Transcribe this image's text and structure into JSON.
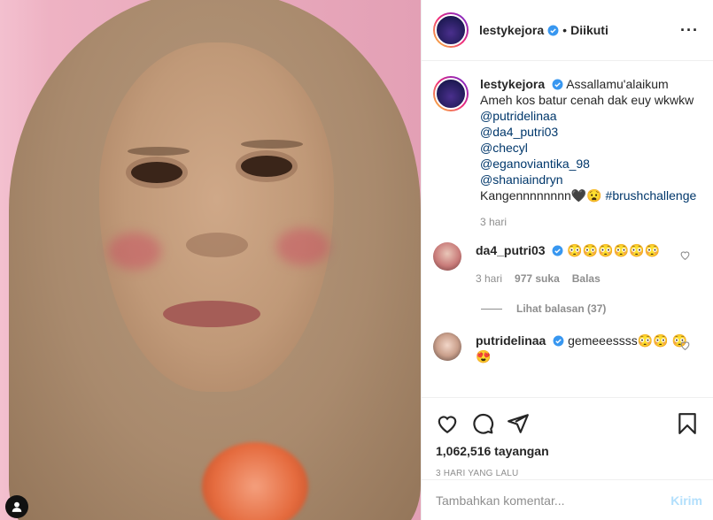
{
  "post": {
    "author": "lestykejora",
    "follow_status": "Diikuti",
    "separator": "•"
  },
  "caption": {
    "username": "lestykejora",
    "first_line": "Assallamu'alaikum",
    "line2": "Ameh kos batur cenah dak euy wkwkw",
    "mentions": [
      "@putridelinaa",
      "@da4_putri03",
      "@checyl",
      "@eganoviantika_98",
      "@shaniaindryn"
    ],
    "last_text": "Kangennnnnnnn🖤😧",
    "hashtag": "#brushchallenge",
    "time": "3 hari"
  },
  "comments": [
    {
      "username": "da4_putri03",
      "text": "😳😳😳😳😳😳",
      "time": "3 hari",
      "likes": "977 suka",
      "reply_label": "Balas",
      "view_replies": "Lihat balasan (37)"
    },
    {
      "username": "putridelinaa",
      "text": "gemeeessss😳😳 😳😍"
    }
  ],
  "stats": {
    "views": "1,062,516 tayangan",
    "time_ago": "3 hari yang lalu"
  },
  "comment_input": {
    "placeholder": "Tambahkan komentar...",
    "post_label": "Kirim"
  },
  "icons": {
    "more": "more-options-icon",
    "like": "heart-icon",
    "comment": "comment-icon",
    "share": "share-icon",
    "save": "bookmark-icon",
    "verified": "verified-badge-icon",
    "user": "user-tag-icon"
  },
  "colors": {
    "link": "#00376b",
    "verified": "#3897f0",
    "muted": "#8e8e8e",
    "post_button": "#b2dffc"
  }
}
